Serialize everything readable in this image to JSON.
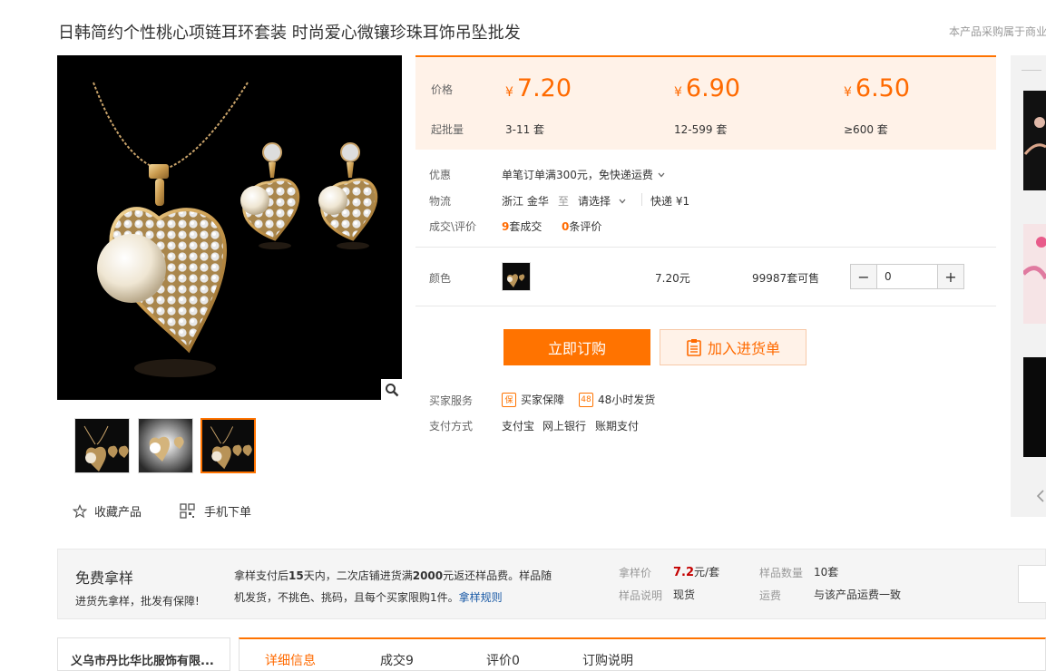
{
  "header": {
    "title": "日韩简约个性桃心项链耳环套装 时尚爱心微镶珍珠耳饰吊坠批发",
    "notice": "本产品采购属于商业"
  },
  "gallery": {
    "thumbnails": 3,
    "active_thumbnail": 3,
    "favorite_label": "收藏产品",
    "mobile_label": "手机下单"
  },
  "pricing": {
    "price_label": "价格",
    "moq_label": "起批量",
    "currency": "¥",
    "tiers": [
      {
        "price": "7.20",
        "range": "3-11 套"
      },
      {
        "price": "6.90",
        "range": "12-599 套"
      },
      {
        "price": "6.50",
        "range": "≥600 套"
      }
    ]
  },
  "details": {
    "promo_label": "优惠",
    "promo_value": "单笔订单满300元，免快递运费",
    "logistics_label": "物流",
    "from": "浙江 金华",
    "to_word": "至",
    "select_placeholder": "请选择",
    "express": "快递 ¥1",
    "deals_label": "成交\\评价",
    "deals_count": "9",
    "deals_suffix": "套成交",
    "reviews_count": "0",
    "reviews_suffix": "条评价"
  },
  "sku": {
    "color_label": "颜色",
    "price": "7.20元",
    "stock": "99987套可售",
    "quantity": "0",
    "minus": "−",
    "plus": "+"
  },
  "actions": {
    "buy_now": "立即订购",
    "add_to_cart": "加入进货单"
  },
  "services": {
    "buyer_service_label": "买家服务",
    "guarantee_icon": "保",
    "guarantee": "买家保障",
    "ship_icon": "48",
    "ship": "48小时发货",
    "payment_label": "支付方式",
    "payments": [
      "支付宝",
      "网上银行",
      "账期支付"
    ]
  },
  "sample": {
    "title": "免费拿样",
    "subtitle": "进货先拿样，批发有保障!",
    "desc_1a": "拿样支付后",
    "desc_1b": "15",
    "desc_1c": "天内，二次店铺进货满",
    "desc_1d": "2000",
    "desc_1e": "元返还样品费。样品随",
    "desc_2": "机发货，不挑色、挑码，且每个买家限购1件。",
    "rules_link": "拿样规则",
    "price_label": "拿样价",
    "price_value": "7.2",
    "price_unit": "元/套",
    "qty_label": "样品数量",
    "qty_value": "10套",
    "note_label": "样品说明",
    "note_value": "现货",
    "freight_label": "运费",
    "freight_value": "与该产品运费一致"
  },
  "shop": {
    "name": "义乌市丹比华比服饰有限..."
  },
  "tabs": [
    "详细信息",
    "成交9",
    "评价0",
    "订购说明"
  ],
  "colors": {
    "accent": "#ff7300",
    "price": "#ff6a00",
    "price_bg": "#fff2e8",
    "sample_price": "#c40000",
    "link": "#1a5aa6"
  }
}
